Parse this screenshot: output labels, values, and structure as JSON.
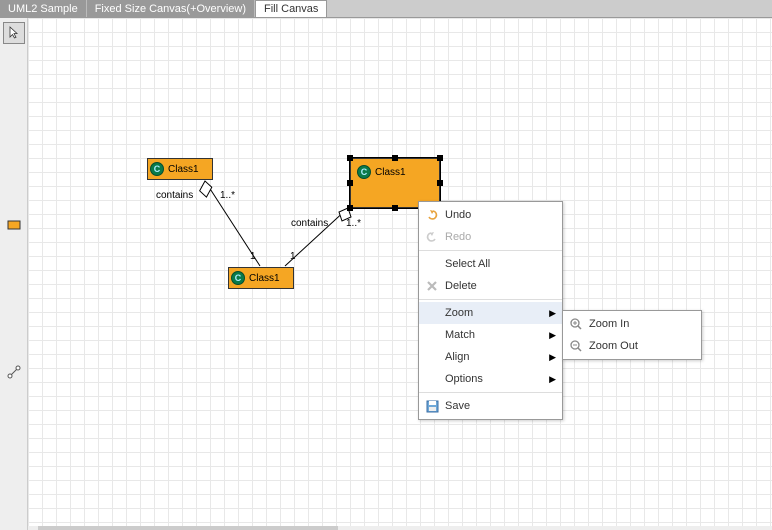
{
  "tabs": [
    {
      "label": "UML2 Sample",
      "active": false
    },
    {
      "label": "Fixed Size Canvas(+Overview)",
      "active": false
    },
    {
      "label": "Fill Canvas",
      "active": true
    }
  ],
  "nodes": {
    "n1": {
      "label": "Class1",
      "icon": "C"
    },
    "n2": {
      "label": "Class1",
      "icon": "C"
    },
    "n3": {
      "label": "Class1",
      "icon": "C"
    }
  },
  "edges": {
    "e1": {
      "label": "contains",
      "srcMult": "1",
      "tgtMult": "1..*"
    },
    "e2": {
      "label": "contains",
      "srcMult": "1",
      "tgtMult": "1..*"
    }
  },
  "contextMenu": {
    "undo": "Undo",
    "redo": "Redo",
    "selectAll": "Select All",
    "delete": "Delete",
    "zoom": "Zoom",
    "match": "Match",
    "align": "Align",
    "options": "Options",
    "save": "Save"
  },
  "zoomSubmenu": {
    "zoomIn": "Zoom In",
    "zoomOut": "Zoom Out"
  },
  "colors": {
    "nodeFill": "#f5a623",
    "classIconBg": "#0a7a4a",
    "tabBg": "#999",
    "grid": "#e8e8e8"
  }
}
